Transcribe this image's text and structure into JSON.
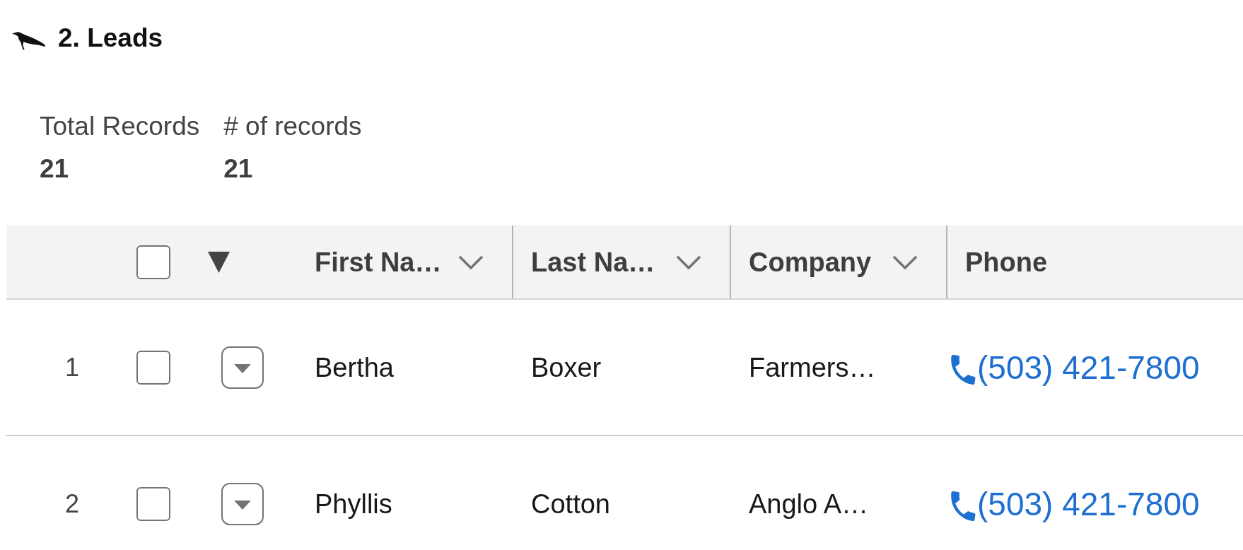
{
  "section": {
    "title": "2. Leads"
  },
  "summary": [
    {
      "label": "Total Records",
      "value": "21"
    },
    {
      "label": "# of records",
      "value": "21"
    }
  ],
  "table": {
    "select_all": {
      "checked": false
    },
    "columns": [
      {
        "label": "First Na…",
        "menu": true
      },
      {
        "label": "Last Na…",
        "menu": true
      },
      {
        "label": "Company",
        "menu": true
      },
      {
        "label": "Phone",
        "menu": false
      }
    ],
    "rows": [
      {
        "number": "1",
        "selected": false,
        "first_name": "Bertha",
        "last_name": "Boxer",
        "company": "Farmers…",
        "phone": "(503) 421-7800"
      },
      {
        "number": "2",
        "selected": false,
        "first_name": "Phyllis",
        "last_name": "Cotton",
        "company": "Anglo A…",
        "phone": "(503) 421-7800"
      }
    ]
  }
}
